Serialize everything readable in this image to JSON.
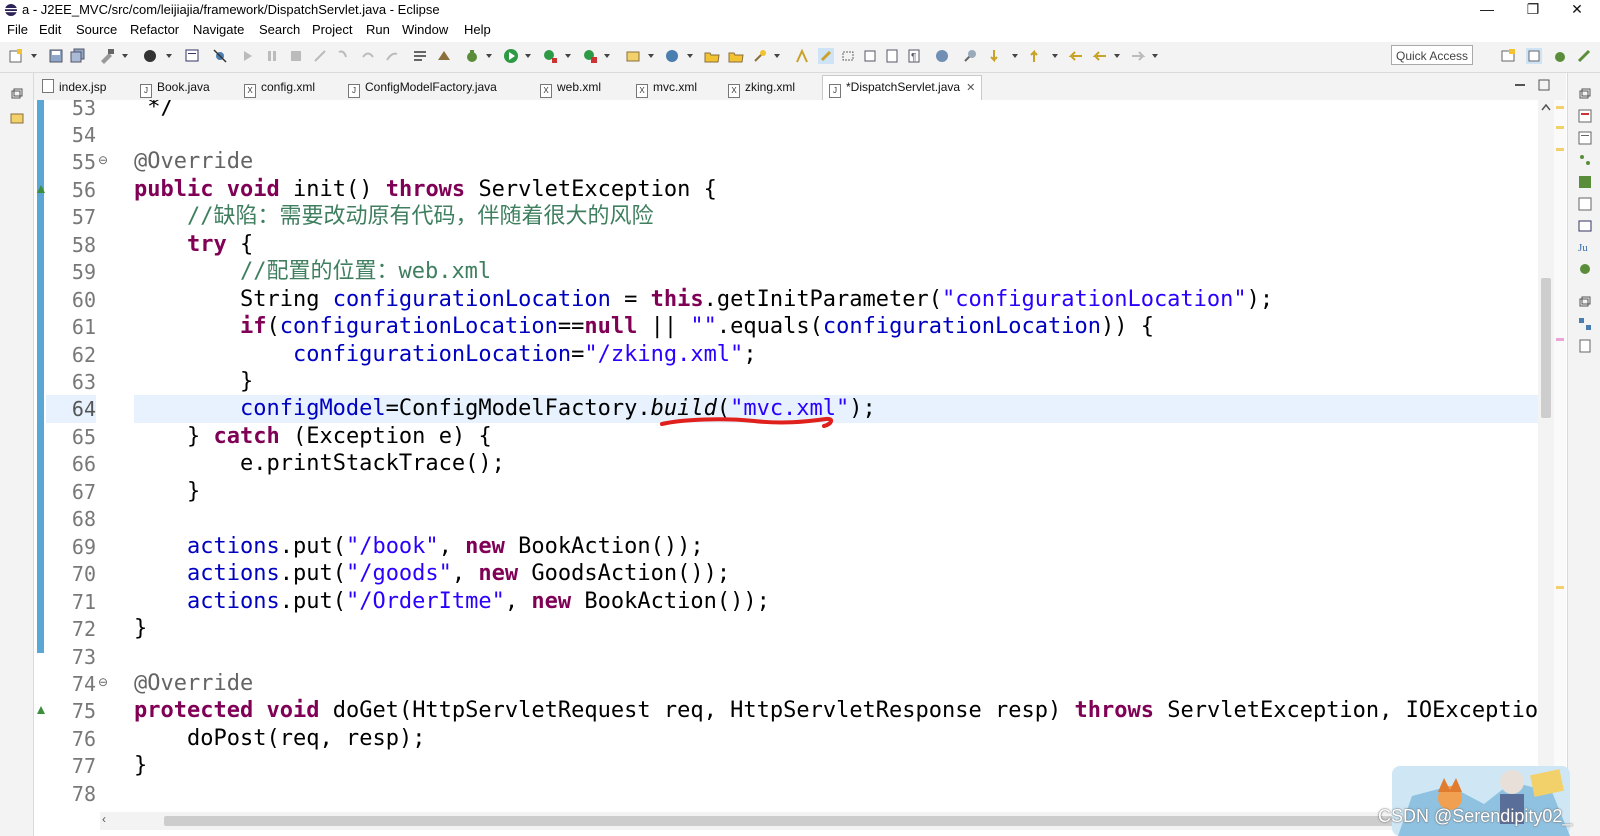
{
  "window": {
    "title": "a - J2EE_MVC/src/com/leijiajia/framework/DispatchServlet.java - Eclipse",
    "controls": {
      "minimize": "—",
      "maximize": "❐",
      "close": "✕"
    }
  },
  "menu": [
    "File",
    "Edit",
    "Source",
    "Refactor",
    "Navigate",
    "Search",
    "Project",
    "Run",
    "Window",
    "Help"
  ],
  "toolbar": {
    "quick_access": "Quick Access"
  },
  "tabs": [
    {
      "label": "index.jsp",
      "icon": "jsp-file-icon"
    },
    {
      "label": "Book.java",
      "icon": "java-file-icon"
    },
    {
      "label": "config.xml",
      "icon": "xml-file-icon"
    },
    {
      "label": "ConfigModelFactory.java",
      "icon": "java-file-icon"
    },
    {
      "label": "web.xml",
      "icon": "xml-file-icon"
    },
    {
      "label": "mvc.xml",
      "icon": "xml-file-icon"
    },
    {
      "label": "zking.xml",
      "icon": "xml-file-icon"
    },
    {
      "label": "*DispatchServlet.java",
      "icon": "java-file-icon",
      "active": true
    }
  ],
  "editor": {
    "current_line": "64",
    "lines": [
      {
        "n": "53",
        "t": " */"
      },
      {
        "n": "54",
        "t": ""
      },
      {
        "n": "55",
        "t": "@Override"
      },
      {
        "n": "56",
        "t": "public void init() throws ServletException {"
      },
      {
        "n": "57",
        "t": "    //缺陷：需要改动原有代码，伴随着很大的风险"
      },
      {
        "n": "58",
        "t": "    try {"
      },
      {
        "n": "59",
        "t": "        //配置的位置：web.xml"
      },
      {
        "n": "60",
        "t": "        String configurationLocation = this.getInitParameter(\"configurationLocation\");"
      },
      {
        "n": "61",
        "t": "        if(configurationLocation==null || \"\".equals(configurationLocation)) {"
      },
      {
        "n": "62",
        "t": "            configurationLocation=\"/zking.xml\";"
      },
      {
        "n": "63",
        "t": "        }"
      },
      {
        "n": "64",
        "t": "        configModel=ConfigModelFactory.build(\"mvc.xml\");"
      },
      {
        "n": "65",
        "t": "    } catch (Exception e) {"
      },
      {
        "n": "66",
        "t": "        e.printStackTrace();"
      },
      {
        "n": "67",
        "t": "    }"
      },
      {
        "n": "68",
        "t": ""
      },
      {
        "n": "69",
        "t": "    actions.put(\"/book\", new BookAction());"
      },
      {
        "n": "70",
        "t": "    actions.put(\"/goods\", new GoodsAction());"
      },
      {
        "n": "71",
        "t": "    actions.put(\"/OrderItme\", new BookAction());"
      },
      {
        "n": "72",
        "t": "}"
      },
      {
        "n": "73",
        "t": ""
      },
      {
        "n": "74",
        "t": "@Override"
      },
      {
        "n": "75",
        "t": "protected void doGet(HttpServletRequest req, HttpServletResponse resp) throws ServletException, IOException {"
      },
      {
        "n": "76",
        "t": "    doPost(req, resp);"
      },
      {
        "n": "77",
        "t": "}"
      },
      {
        "n": "78",
        "t": ""
      }
    ]
  },
  "colors": {
    "keyword": "#7f0055",
    "field": "#0000c0",
    "string": "#2a00ff",
    "comment": "#3f7f5f",
    "annotation": "#646464",
    "current_line_bg": "#e8f2fe",
    "fold_stripe": "#5aa6d4",
    "annotation_stroke": "#e0201c"
  },
  "watermark": "CSDN @Serendipity02_"
}
